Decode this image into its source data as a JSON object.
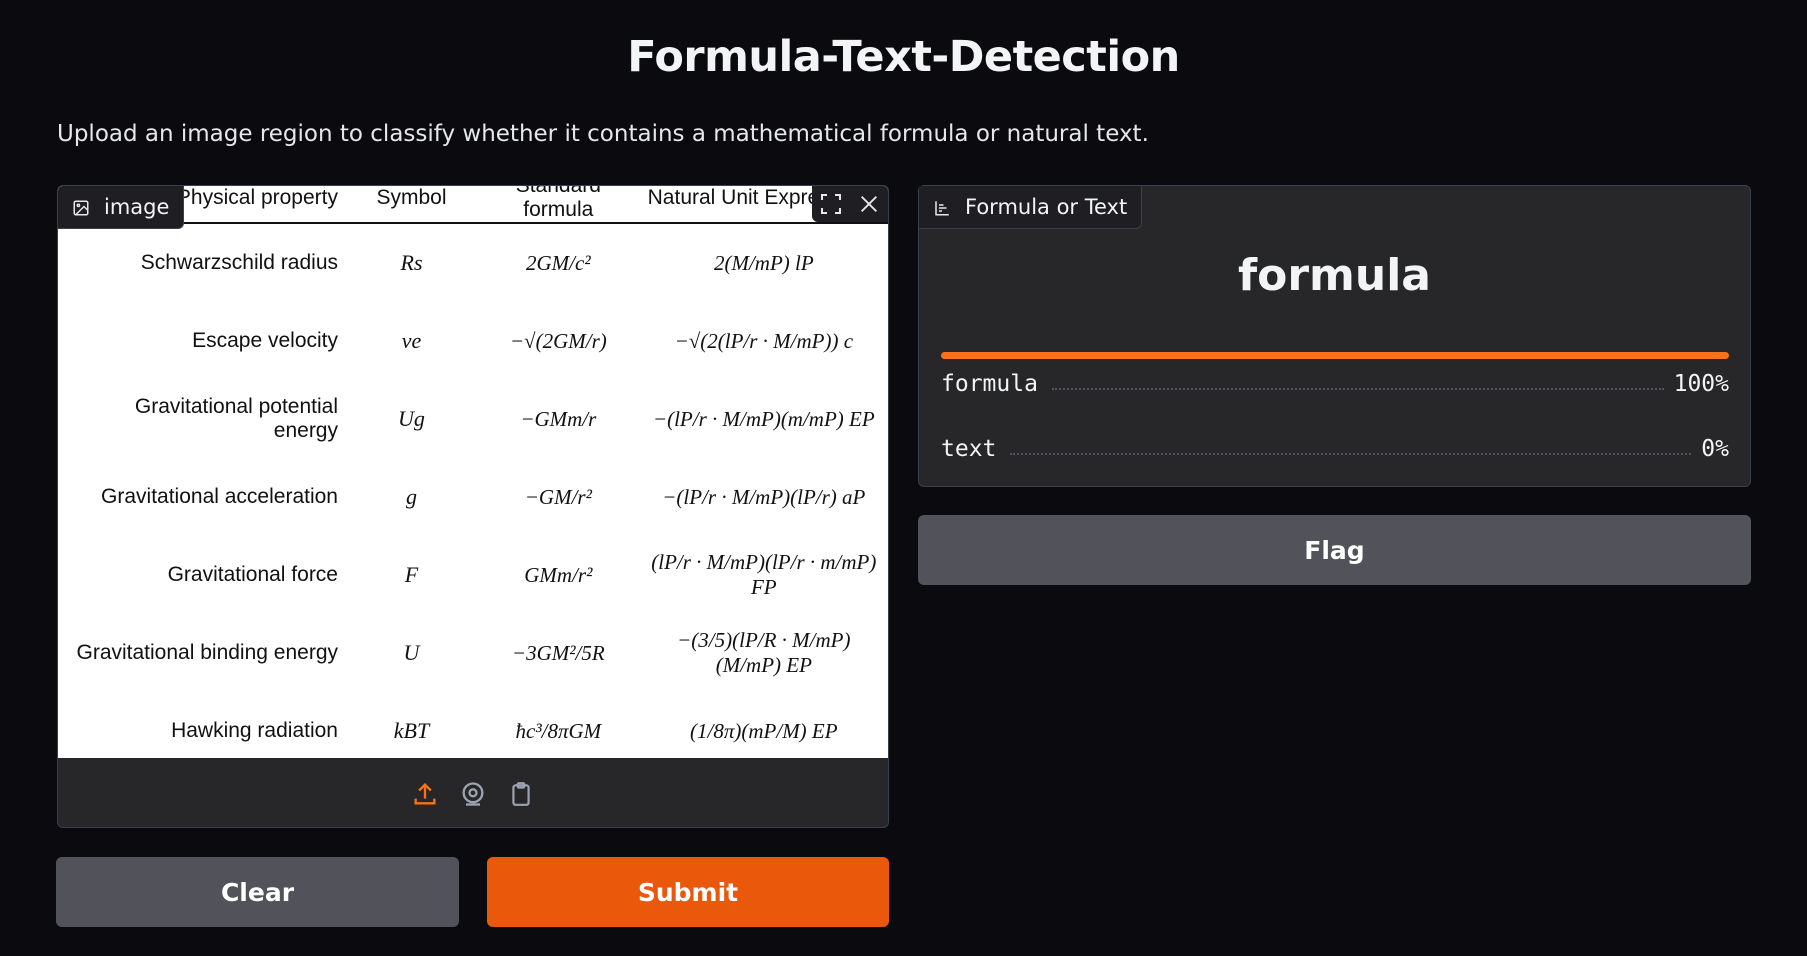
{
  "page": {
    "title": "Formula-Text-Detection",
    "description": "Upload an image region to classify whether it contains a mathematical formula or natural text."
  },
  "input_panel": {
    "tag_label": "image",
    "tag_icon": "image-icon",
    "table": {
      "headers": [
        "Physical property",
        "Symbol",
        "Standard formula",
        "Natural Unit Expression"
      ],
      "rows": [
        {
          "property": "Schwarzschild radius",
          "symbol": "Rs",
          "standard": "2GM/c²",
          "natural": "2(M/mP) lP"
        },
        {
          "property": "Escape velocity",
          "symbol": "ve",
          "standard": "−√(2GM/r)",
          "natural": "−√(2(lP/r · M/mP)) c"
        },
        {
          "property": "Gravitational potential energy",
          "symbol": "Ug",
          "standard": "−GMm/r",
          "natural": "−(lP/r · M/mP)(m/mP) EP"
        },
        {
          "property": "Gravitational acceleration",
          "symbol": "g",
          "standard": "−GM/r²",
          "natural": "−(lP/r · M/mP)(lP/r) aP"
        },
        {
          "property": "Gravitational force",
          "symbol": "F",
          "standard": "GMm/r²",
          "natural": "(lP/r · M/mP)(lP/r · m/mP) FP"
        },
        {
          "property": "Gravitational binding energy",
          "symbol": "U",
          "standard": "−3GM²/5R",
          "natural": "−(3/5)(lP/R · M/mP)(M/mP) EP"
        },
        {
          "property": "Hawking radiation",
          "symbol": "kBT",
          "standard": "ħc³/8πGM",
          "natural": "(1/8π)(mP/M) EP"
        }
      ]
    },
    "toolbar": [
      "upload-icon",
      "webcam-icon",
      "clipboard-icon"
    ]
  },
  "output_panel": {
    "tag_label": "Formula or Text",
    "tag_icon": "bar-chart-icon",
    "predicted_label": "formula",
    "confidences": [
      {
        "label": "formula",
        "percent_text": "100%",
        "value": 1.0
      },
      {
        "label": "text",
        "percent_text": "0%",
        "value": 0.0
      }
    ]
  },
  "buttons": {
    "flag": "Flag",
    "clear": "Clear",
    "submit": "Submit"
  },
  "colors": {
    "background": "#0b0b0f",
    "panel": "#27272a",
    "accent": "#ea580c",
    "bar": "#f97316",
    "secondary_button": "#52525b"
  }
}
